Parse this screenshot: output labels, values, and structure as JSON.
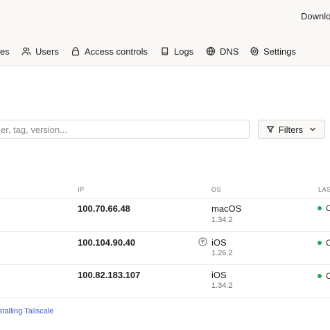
{
  "header": {
    "download_label": "Download"
  },
  "nav": {
    "machines_partial": "es",
    "users": "Users",
    "access_controls": "Access controls",
    "logs": "Logs",
    "dns": "DNS",
    "settings": "Settings"
  },
  "search": {
    "placeholder": "er, tag, version..."
  },
  "filters": {
    "label": "Filters"
  },
  "table": {
    "headers": {
      "ip": "IP",
      "os": "OS",
      "last_seen": "LAS"
    },
    "rows": [
      {
        "ip": "100.70.66.48",
        "os": "macOS",
        "version": "1.34.2",
        "status": "C",
        "update_available": false
      },
      {
        "ip": "100.104.90.40",
        "os": "iOS",
        "version": "1.26.2",
        "status": "C",
        "update_available": true
      },
      {
        "ip": "100.82.183.107",
        "os": "iOS",
        "version": "1.34.2",
        "status": "C",
        "update_available": false
      }
    ]
  },
  "footer": {
    "link": "stalling Tailscale"
  },
  "colors": {
    "online": "#28a35a",
    "link": "#3f5fbf",
    "topbar_bg": "#f9f8f7"
  }
}
